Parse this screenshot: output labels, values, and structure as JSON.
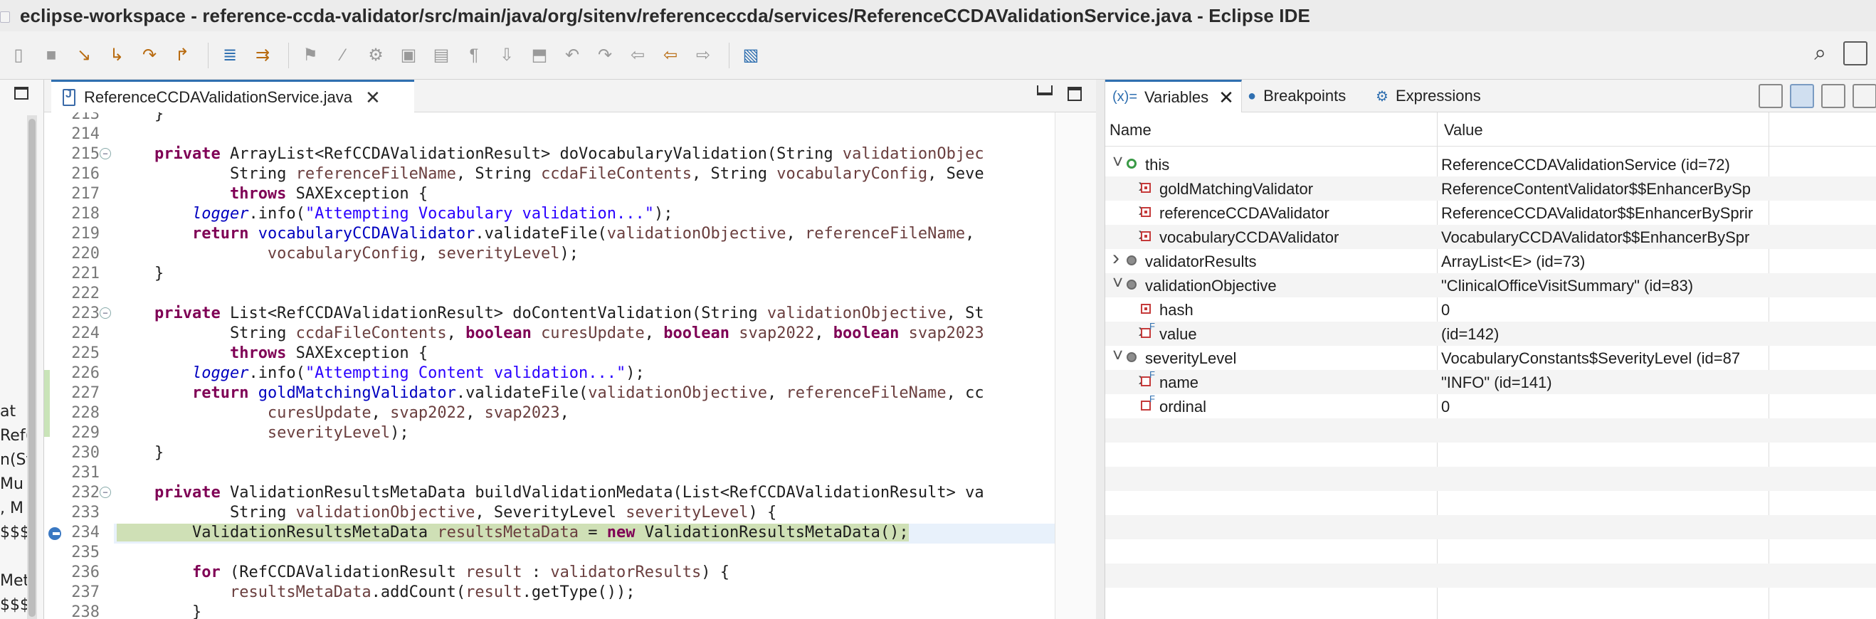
{
  "window": {
    "title": "eclipse-workspace - reference-ccda-validator/src/main/java/org/sitenv/referenceccda/services/ReferenceCCDAValidationService.java - Eclipse IDE"
  },
  "toolbar": {
    "buttons": [
      "skip-all-breakpoints",
      "terminate",
      "disconnect",
      "step-into",
      "step-over",
      "step-return",
      "drop-to-frame",
      "use-step-filters",
      "run",
      "debug",
      "coverage",
      "profile",
      "external-tools",
      "new-java-project",
      "new-package",
      "new-class",
      "open-type",
      "search",
      "next-annotation",
      "previous-annotation",
      "last-edit-location",
      "back",
      "forward",
      "open-perspective"
    ],
    "search_icon": "search-icon"
  },
  "left_pane": {
    "fragments": [
      "at",
      "Ref(",
      "n(St",
      "Mu",
      ", M",
      "$$$",
      "Met",
      "$$$"
    ]
  },
  "editor": {
    "tab_label": "ReferenceCCDAValidationService.java",
    "lines": [
      {
        "n": "213",
        "t": "    }"
      },
      {
        "n": "214",
        "t": ""
      },
      {
        "n": "215",
        "fold": true,
        "t": "    private ArrayList<RefCCDAValidationResult> doVocabularyValidation(String validationObjec"
      },
      {
        "n": "216",
        "t": "            String referenceFileName, String ccdaFileContents, String vocabularyConfig, Seve"
      },
      {
        "n": "217",
        "t": "            throws SAXException {"
      },
      {
        "n": "218",
        "t": "        logger.info(\"Attempting Vocabulary validation...\");"
      },
      {
        "n": "219",
        "t": "        return vocabularyCCDAValidator.validateFile(validationObjective, referenceFileName,"
      },
      {
        "n": "220",
        "t": "                vocabularyConfig, severityLevel);"
      },
      {
        "n": "221",
        "t": "    }"
      },
      {
        "n": "222",
        "t": ""
      },
      {
        "n": "223",
        "fold": true,
        "t": "    private List<RefCCDAValidationResult> doContentValidation(String validationObjective, St"
      },
      {
        "n": "224",
        "t": "            String ccdaFileContents, boolean curesUpdate, boolean svap2022, boolean svap2023"
      },
      {
        "n": "225",
        "t": "            throws SAXException {"
      },
      {
        "n": "226",
        "t": "        logger.info(\"Attempting Content validation...\");"
      },
      {
        "n": "227",
        "t": "        return goldMatchingValidator.validateFile(validationObjective, referenceFileName, cc"
      },
      {
        "n": "228",
        "t": "                curesUpdate, svap2022, svap2023,"
      },
      {
        "n": "229",
        "t": "                severityLevel);"
      },
      {
        "n": "230",
        "t": "    }"
      },
      {
        "n": "231",
        "t": ""
      },
      {
        "n": "232",
        "fold": true,
        "t": "    private ValidationResultsMetaData buildValidationMedata(List<RefCCDAValidationResult> va"
      },
      {
        "n": "233",
        "t": "            String validationObjective, SeverityLevel severityLevel) {"
      },
      {
        "n": "234",
        "hl": true,
        "bp": true,
        "t": "        ValidationResultsMetaData resultsMetaData = new ValidationResultsMetaData();"
      },
      {
        "n": "235",
        "t": ""
      },
      {
        "n": "236",
        "t": "        for (RefCCDAValidationResult result : validatorResults) {"
      },
      {
        "n": "237",
        "t": "            resultsMetaData.addCount(result.getType());"
      },
      {
        "n": "238",
        "t": "        }"
      }
    ]
  },
  "variables_view": {
    "tabs": [
      {
        "icon": "(x)=",
        "label": "Variables"
      },
      {
        "icon": "breakpoints-icon",
        "label": "Breakpoints"
      },
      {
        "icon": "expressions-icon",
        "label": "Expressions"
      }
    ],
    "headers": {
      "name": "Name",
      "value": "Value"
    },
    "rows": [
      {
        "level": 0,
        "tw": "expanded",
        "icon": "dot-green",
        "name": "this",
        "value": "ReferenceCCDAValidationService  (id=72)"
      },
      {
        "level": 1,
        "tw": "collapsed",
        "icon": "sq-red",
        "name": "goldMatchingValidator",
        "value": "ReferenceContentValidator$$EnhancerBySp"
      },
      {
        "level": 1,
        "tw": "collapsed",
        "icon": "sq-red",
        "name": "referenceCCDAValidator",
        "value": "ReferenceCCDAValidator$$EnhancerBySprir"
      },
      {
        "level": 1,
        "tw": "collapsed",
        "icon": "sq-red",
        "name": "vocabularyCCDAValidator",
        "value": "VocabularyCCDAValidator$$EnhancerBySpr"
      },
      {
        "level": 0,
        "tw": "collapsed",
        "icon": "circ-grey",
        "name": "validatorResults",
        "value": "ArrayList<E>  (id=73)"
      },
      {
        "level": 0,
        "tw": "expanded",
        "icon": "circ-grey",
        "name": "validationObjective",
        "value": "\"ClinicalOfficeVisitSummary\" (id=83)"
      },
      {
        "level": 1,
        "tw": "",
        "icon": "sq-red",
        "name": "hash",
        "value": "0"
      },
      {
        "level": 1,
        "tw": "collapsed",
        "icon": "final",
        "name": "value",
        "value": "(id=142)"
      },
      {
        "level": 0,
        "tw": "expanded",
        "icon": "circ-grey",
        "name": "severityLevel",
        "value": "VocabularyConstants$SeverityLevel  (id=87"
      },
      {
        "level": 1,
        "tw": "collapsed",
        "icon": "final",
        "name": "name",
        "value": "\"INFO\" (id=141)"
      },
      {
        "level": 1,
        "tw": "",
        "icon": "final",
        "name": "ordinal",
        "value": "0"
      }
    ]
  }
}
